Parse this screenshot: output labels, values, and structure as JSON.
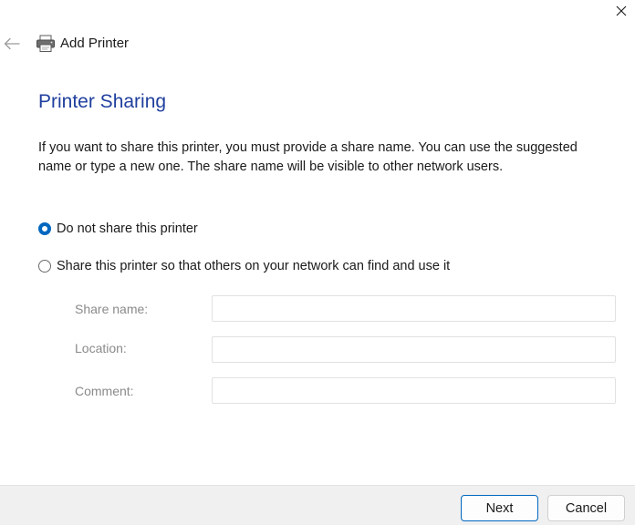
{
  "window": {
    "close_icon": "close-icon"
  },
  "header": {
    "back_icon": "back-arrow-icon",
    "app_icon": "printer-icon",
    "title": "Add Printer"
  },
  "page": {
    "heading": "Printer Sharing",
    "description": "If you want to share this printer, you must provide a share name. You can use the suggested name or type a new one. The share name will be visible to other network users."
  },
  "sharing_options": [
    {
      "label": "Do not share this printer",
      "selected": true
    },
    {
      "label": "Share this printer so that others on your network can find and use it",
      "selected": false
    }
  ],
  "fields": {
    "share_name": {
      "label": "Share name:",
      "value": ""
    },
    "location": {
      "label": "Location:",
      "value": ""
    },
    "comment": {
      "label": "Comment:",
      "value": ""
    }
  },
  "footer": {
    "next_label": "Next",
    "cancel_label": "Cancel"
  },
  "colors": {
    "heading": "#1f3f9e",
    "accent": "#0067c0",
    "footer_bg": "#f0f0f0"
  }
}
